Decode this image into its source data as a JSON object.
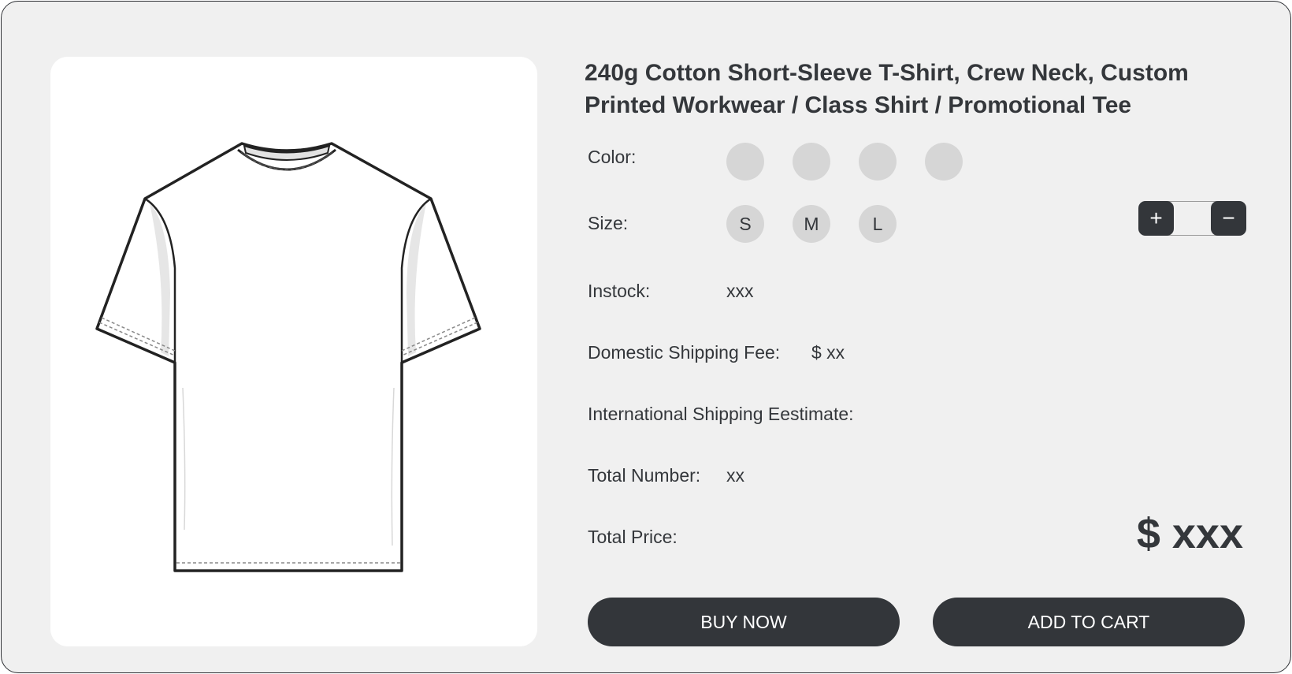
{
  "product": {
    "title_line1": "240g Cotton Short-Sleeve T-Shirt, Crew Neck, Custom",
    "title_line2": "Printed Workwear / Class Shirt / Promotional Tee",
    "image_icon": "t-shirt-illustration"
  },
  "options": {
    "color_label": "Color:",
    "size_label": "Size:",
    "sizes": [
      "S",
      "M",
      "L"
    ],
    "color_swatches": [
      "#d6d6d6",
      "#d6d6d6",
      "#d6d6d6",
      "#d6d6d6"
    ]
  },
  "quantity": {
    "plus_label": "+",
    "minus_label": "−",
    "plus_icon": "plus-icon",
    "minus_icon": "minus-icon"
  },
  "details": {
    "instock_label": "Instock:",
    "instock_value": "xxx",
    "domestic_label": "Domestic Shipping Fee:",
    "domestic_value": "$ xx",
    "international_label": "International Shipping Eestimate:",
    "total_number_label": "Total Number:",
    "total_number_value": "xx",
    "total_price_label": "Total Price:",
    "total_price_value": "$ xxx"
  },
  "actions": {
    "buy_now": "BUY NOW",
    "add_to_cart": "ADD TO CART"
  },
  "colors": {
    "accent": "#33363a",
    "background": "#f0f0f0",
    "card": "#ffffff",
    "swatch": "#d6d6d6"
  }
}
